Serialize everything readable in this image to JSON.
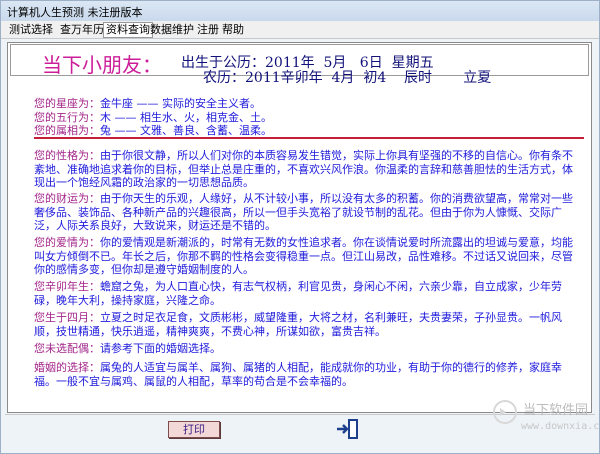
{
  "window": {
    "title": "计算机人生预测 未注册版本"
  },
  "menu": {
    "items": [
      "测试选择",
      "查万年历",
      "资料查询",
      "数据维护",
      "注册",
      "帮助"
    ]
  },
  "header": {
    "greeting": "当下小朋友：",
    "birth_line": "出生于公历：2011年  5月   6日  星期五",
    "lunar_line": "农历：2011辛卯年  4月  初4    辰时       立夏"
  },
  "sections": [
    {
      "label": "您的星座为：",
      "text": "金牛座 —— 实际的安全主义者。"
    },
    {
      "label": "您的五行为：",
      "text": "木 —— 相生水、火，相克金、土。"
    },
    {
      "label": "您的属相为：",
      "text": "兔 —— 文雅、善良、含蓄、温柔。"
    },
    {
      "label": "您的性格为：",
      "text": "由于你很文静，所以人们对你的本质容易发生错觉，实际上你具有坚强的不移的自信心。你有条不紊地、准确地追求着你的目标，但举止总是庄重的，不喜欢兴风作浪。你温柔的言辞和慈善胆怯的生活方式，体现出一个饱经风霜的政治家的一切思想品质。"
    },
    {
      "label": "您的财运为：",
      "text": "由于你天生的乐观，人缘好，从不计较小事，所以没有太多的积蓄。你的消费欲望高，常常对一些奢侈品、装饰品、各种新产品的兴趣很高，所以一但手头宽裕了就设节制的乱花。但由于你为人慷慨、交际广泛，人际关系良好，大致说来，财运还是不错的。"
    },
    {
      "label": "您的爱情为：",
      "text": "你的爱情观是新潮派的，时常有无数的女性追求者。你在谈情说爱时所流露出的坦诚与爱意，均能叫女方倾倒不已。年长之后，你那不羁的性格会变得稳重一点。但江山易改，品性难移。不过话又说回来，尽管你的感情多变，但你却是遵守婚姻制度的人。"
    },
    {
      "label": "您辛卯年生：",
      "text": "蟾窟之兔，为人口直心快，有志气权柄，利官见贵，身闲心不闲，六亲少靠，自立成家，少年劳碌，晚年大利，操持家庭，兴隆之命。"
    },
    {
      "label": "您生于四月：",
      "text": "立夏之时足衣足食，文质彬彬，威望隆重，大将之材，名利兼旺，夫贵妻荣，子孙显贵。一帆风顺，技世精通，快乐逍遥，精神爽爽，不费心神，所谋如欲，富贵吉祥。"
    },
    {
      "label": "您未选配偶：",
      "text": "请参考下面的婚姻选择。"
    },
    {
      "label": "婚姻的选择：",
      "text": "属兔的人适宜与属羊、属狗、属猪的人相配，能成就你的功业，有助于你的德行的修养，家庭幸福。一般不宜与属鸡、属鼠的人相配，草率的苟合是不会幸福的。"
    }
  ],
  "buttons": {
    "print_label": "打印"
  },
  "watermark": {
    "brand_cn": "当下软件园",
    "brand_url": "www.downxia.com"
  }
}
